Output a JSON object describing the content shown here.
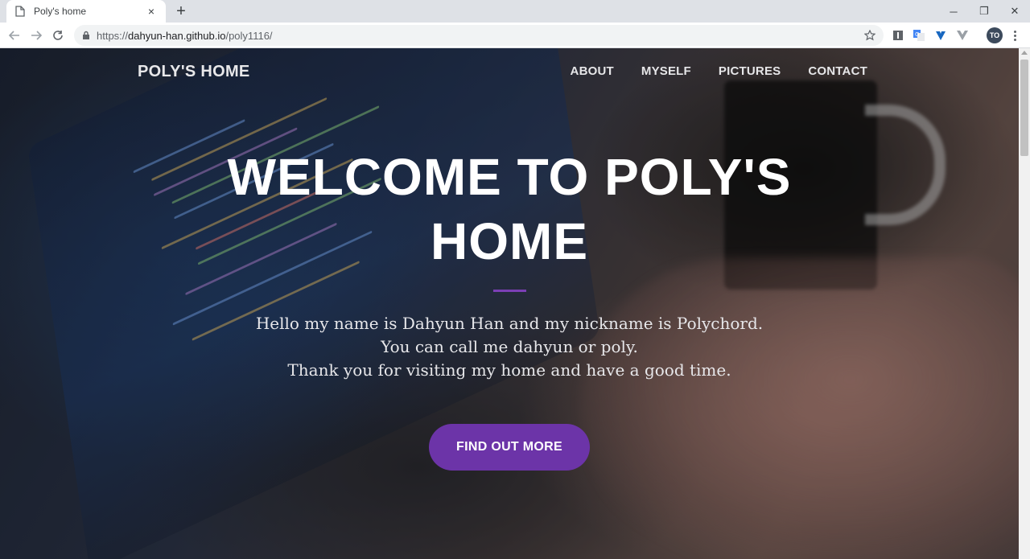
{
  "browser": {
    "tab": {
      "title": "Poly's home",
      "favicon": "page-icon",
      "close": "×"
    },
    "new_tab": "+",
    "window_controls": {
      "minimize": "─",
      "restore": "❐",
      "close": "✕"
    },
    "address": {
      "scheme": "https://",
      "host": "dahyun-han.github.io",
      "path": "/poly1116/"
    },
    "profile_initials": "TO",
    "extensions": [
      "extension-square-icon",
      "translate-icon",
      "vuetify-icon",
      "vue-devtools-icon"
    ]
  },
  "site": {
    "brand": "POLY'S HOME",
    "nav": [
      {
        "label": "ABOUT"
      },
      {
        "label": "MYSELF"
      },
      {
        "label": "PICTURES"
      },
      {
        "label": "CONTACT"
      }
    ],
    "hero": {
      "title": "WELCOME TO POLY'S HOME",
      "lead": [
        "Hello my name is Dahyun Han and my nickname is Polychord.",
        "You can call me dahyun or poly.",
        "Thank you for visiting my home and have a good time."
      ],
      "cta": "FIND OUT MORE"
    }
  },
  "colors": {
    "accent": "#6c34a8",
    "divider": "#7b3fb5",
    "text": "#ffffff"
  }
}
